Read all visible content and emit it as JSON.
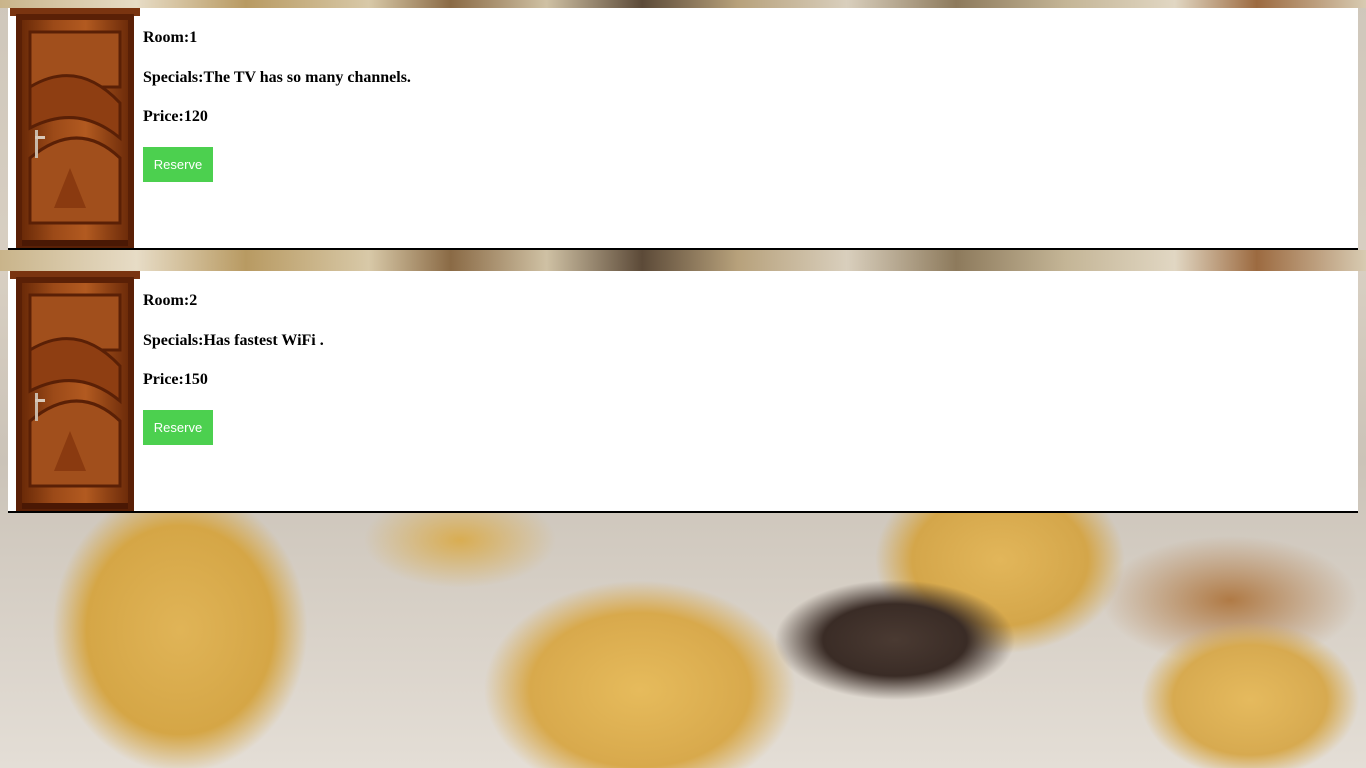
{
  "colors": {
    "reserve_button_bg": "#4cd04f",
    "reserve_button_text": "#ffffff",
    "card_bg": "#ffffff",
    "card_border": "#000000"
  },
  "rooms": [
    {
      "room_label": "Room:1",
      "specials_label": "Specials:The TV has so many channels.",
      "price_label": "Price:120",
      "reserve_label": "Reserve",
      "image_icon": "door-icon"
    },
    {
      "room_label": "Room:2",
      "specials_label": "Specials:Has fastest WiFi .",
      "price_label": "Price:150",
      "reserve_label": "Reserve",
      "image_icon": "door-icon"
    }
  ]
}
